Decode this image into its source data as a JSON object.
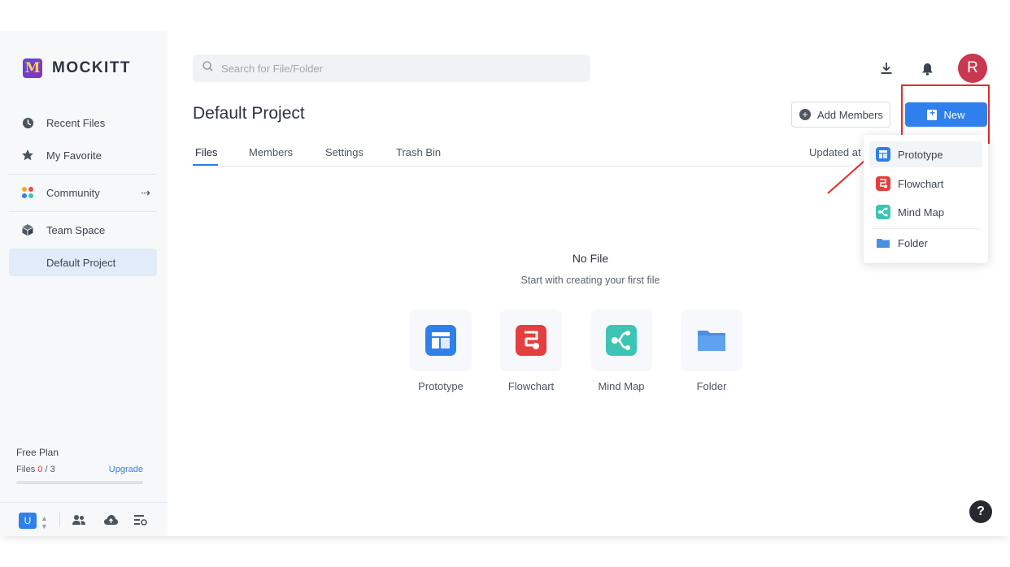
{
  "brand": {
    "name": "MOCKITT"
  },
  "sidebar": {
    "items": [
      {
        "label": "Recent Files",
        "icon": "clock-icon"
      },
      {
        "label": "My Favorite",
        "icon": "star-icon"
      },
      {
        "label": "Community",
        "icon": "community-icon"
      },
      {
        "label": "Team Space",
        "icon": "cube-icon"
      },
      {
        "label": "Default Project"
      }
    ],
    "plan": {
      "title": "Free Plan",
      "files_label": "Files",
      "files_used": "0",
      "files_total": "/ 3",
      "upgrade_label": "Upgrade",
      "usage_fraction": 0
    },
    "bottom": {
      "user_initial": "U"
    }
  },
  "search": {
    "placeholder": "Search for File/Folder"
  },
  "header": {
    "avatar_initial": "R",
    "page_title": "Default Project",
    "add_members_label": "Add Members",
    "new_label": "New"
  },
  "tabs": [
    {
      "label": "Files",
      "active": true
    },
    {
      "label": "Members"
    },
    {
      "label": "Settings"
    },
    {
      "label": "Trash Bin"
    }
  ],
  "sort_label": "Updated at",
  "new_menu": {
    "items": [
      {
        "label": "Prototype",
        "icon": "prototype-icon",
        "color": "#2f80ed"
      },
      {
        "label": "Flowchart",
        "icon": "flowchart-icon",
        "color": "#e53e3e"
      },
      {
        "label": "Mind Map",
        "icon": "mindmap-icon",
        "color": "#3cc5b4"
      },
      {
        "label": "Folder",
        "icon": "folder-icon",
        "color": "#4a90e2"
      }
    ]
  },
  "empty_state": {
    "title": "No File",
    "subtitle": "Start with creating your first file",
    "options": [
      {
        "label": "Prototype"
      },
      {
        "label": "Flowchart"
      },
      {
        "label": "Mind Map"
      },
      {
        "label": "Folder"
      }
    ]
  },
  "help": {
    "label": "?"
  },
  "colors": {
    "accent": "#2f80ed",
    "annotation": "#e32b2b",
    "avatar": "#c8384f"
  }
}
